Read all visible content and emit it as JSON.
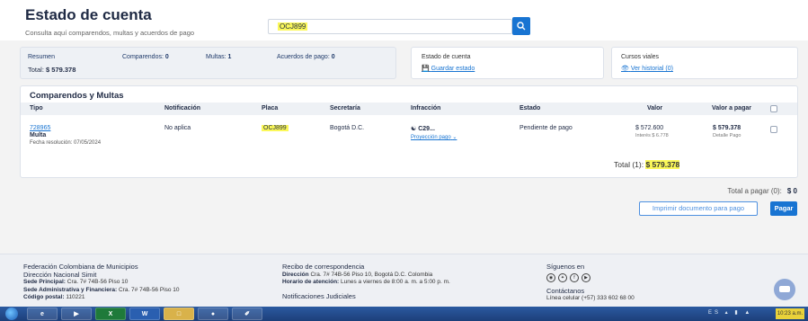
{
  "header": {
    "title": "Estado de cuenta",
    "subtitle": "Consulta aquí comparendos, multas y acuerdos de pago",
    "search_value": "OCJ899"
  },
  "summary": {
    "resumen_label": "Resumen",
    "total_label": "Total:",
    "total_value": "$ 579.378",
    "comparendos_label": "Comparendos:",
    "comparendos_value": "0",
    "multas_label": "Multas:",
    "multas_value": "1",
    "acuerdos_label": "Acuerdos de pago:",
    "acuerdos_value": "0"
  },
  "estado_card": {
    "title": "Estado de cuenta",
    "link": "Guardar estado"
  },
  "cursos_card": {
    "title": "Cursos viales",
    "link": "Ver historial (0)"
  },
  "table": {
    "title": "Comparendos y Multas",
    "headers": [
      "Tipo",
      "Notificación",
      "Placa",
      "Secretaría",
      "Infracción",
      "Estado",
      "Valor",
      "Valor a pagar"
    ],
    "row": {
      "number": "728965",
      "tipo": "Multa",
      "fecha": "Fecha resolución: 07/05/2024",
      "notificacion": "No aplica",
      "placa": "OCJ899",
      "secretaria": "Bogotá D.C.",
      "infraccion": "C29...",
      "proyeccion": "Proyección pago",
      "estado": "Pendiente de pago",
      "valor": "$ 572.600",
      "intereses": "Interés $ 6.778",
      "valor_pagar": "$ 579.378",
      "detalle": "Detalle Pago"
    },
    "total_label": "Total (1):",
    "total_value": "$ 579.378"
  },
  "payment": {
    "total_label": "Total a pagar (0):",
    "total_value": "$ 0",
    "print_label": "Imprimir documento para pago",
    "pay_label": "Pagar"
  },
  "footer": {
    "org1": "Federación Colombiana de Municipios",
    "org2": "Dirección Nacional Simit",
    "sede1_label": "Sede Principal:",
    "sede1": "Cra. 7# 74B-56 Piso 10",
    "sede2_label": "Sede Administrativa y Financiera:",
    "sede2": "Cra. 7# 74B-56 Piso 10",
    "postal_label": "Código postal:",
    "postal": "110221",
    "recibo_title": "Recibo de correspondencia",
    "direccion_label": "Dirección",
    "direccion": "Cra. 7# 74B-56 Piso 10, Bogotá D.C. Colombia",
    "horario_label": "Horario de atención:",
    "horario": "Lunes a viernes de 8:00 a. m. a 5:00 p. m.",
    "notificaciones": "Notificaciones Judiciales",
    "siguenos": "Síguenos en",
    "contactanos": "Contáctanos",
    "linea": "Línea celular (+57) 333 602 68 00"
  },
  "taskbar": {
    "clock": "10:23 a.m."
  }
}
